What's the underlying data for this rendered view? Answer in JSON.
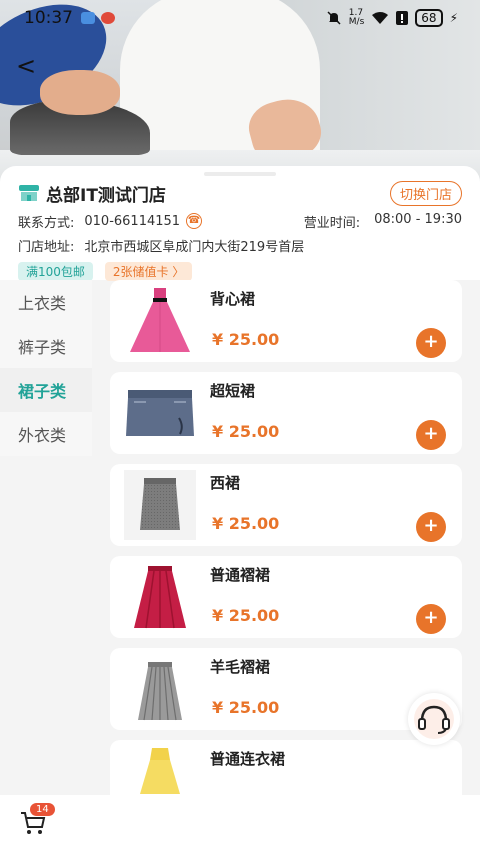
{
  "status_bar": {
    "time": "10:37",
    "net_speed": "1.7\nM/s",
    "battery": "68"
  },
  "store": {
    "name": "总部IT测试门店",
    "switch_label": "切换门店",
    "contact_label": "联系方式:",
    "phone": "010-66114151",
    "hours_label": "营业时间:",
    "hours": "08:00 - 19:30",
    "address_label": "门店地址:",
    "address": "北京市西城区阜成门内大街219号首层",
    "tags": [
      "满100包邮",
      "2张储值卡 〉"
    ]
  },
  "categories": [
    {
      "label": "上衣类",
      "active": false
    },
    {
      "label": "裤子类",
      "active": false
    },
    {
      "label": "裙子类",
      "active": true
    },
    {
      "label": "外衣类",
      "active": false
    }
  ],
  "products": [
    {
      "name": "背心裙",
      "price": "¥ 25.00",
      "image": "pink-dress"
    },
    {
      "name": "超短裙",
      "price": "¥ 25.00",
      "image": "denim-mini-skirt"
    },
    {
      "name": "西裙",
      "price": "¥ 25.00",
      "image": "grey-pencil-skirt"
    },
    {
      "name": "普通褶裙",
      "price": "¥ 25.00",
      "image": "red-pleated-skirt"
    },
    {
      "name": "羊毛褶裙",
      "price": "¥ 25.00",
      "image": "grey-wool-pleated-skirt"
    },
    {
      "name": "普通连衣裙",
      "price": "",
      "image": "yellow-dress"
    }
  ],
  "add_label": "+",
  "cart": {
    "count": "14"
  },
  "colors": {
    "accent": "#e8742a",
    "teal": "#22a398",
    "badge": "#e85336"
  }
}
